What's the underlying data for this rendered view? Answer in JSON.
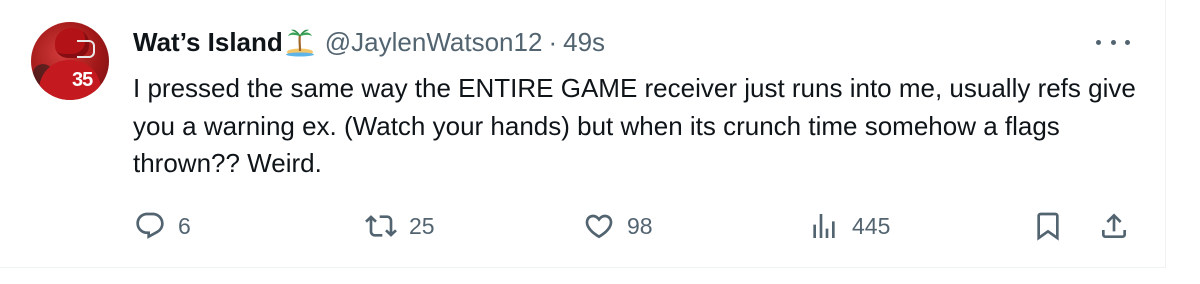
{
  "author": {
    "display_name": "Wat’s Island",
    "name_emoji": "desert-island-icon",
    "handle": "@JaylenWatson12",
    "separator": "·",
    "time": "49s",
    "avatar": "avatar-football-player",
    "avatar_number": "35"
  },
  "tweet": {
    "text": "I pressed the same way the ENTIRE GAME receiver just runs into me, usually refs give you a warning ex. (Watch your hands) but when its crunch time somehow a flags thrown?? Weird."
  },
  "menu": {
    "more_icon": "more-options-icon"
  },
  "actions": {
    "reply": {
      "icon": "reply-icon",
      "count": "6"
    },
    "retweet": {
      "icon": "retweet-icon",
      "count": "25"
    },
    "like": {
      "icon": "heart-icon",
      "count": "98"
    },
    "views": {
      "icon": "views-icon",
      "count": "445"
    },
    "bookmark": {
      "icon": "bookmark-icon"
    },
    "share": {
      "icon": "share-icon"
    }
  },
  "colors": {
    "text_primary": "#0f1419",
    "text_secondary": "#536471",
    "border": "#eff3f4",
    "avatar_red": "#c41a1f"
  }
}
